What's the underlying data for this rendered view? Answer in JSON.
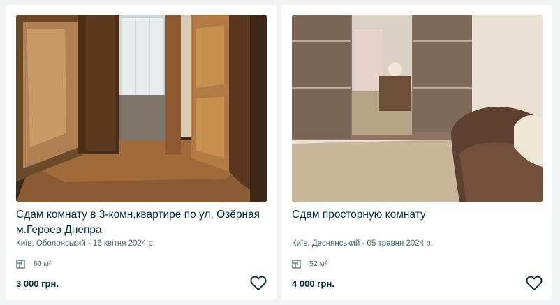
{
  "listings": [
    {
      "title": "Сдам комнату в 3-комн,квартире по ул, Озёрная м.Героев Днепра",
      "location_date": "Київ, Оболонський - 16 квітня 2024 р.",
      "area": "60 м²",
      "price": "3 000 грн.",
      "area_icon": "floor-plan-icon",
      "favorite_icon": "heart-outline-icon"
    },
    {
      "title": "Сдам просторную комнату",
      "location_date": "Київ, Деснянський - 05 травня 2024 р.",
      "area": "52 м²",
      "price": "4 000 грн.",
      "area_icon": "floor-plan-icon",
      "favorite_icon": "heart-outline-icon"
    }
  ],
  "colors": {
    "text_primary": "#002f34",
    "text_secondary": "#406367",
    "page_background": "#f2f4f5",
    "card_background": "#ffffff"
  }
}
